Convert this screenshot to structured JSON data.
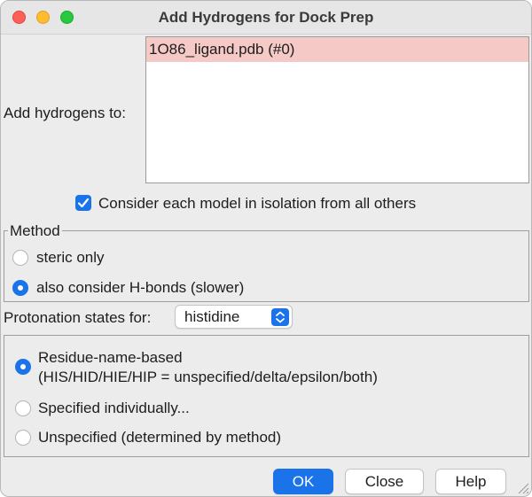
{
  "window": {
    "title": "Add Hydrogens for Dock Prep",
    "traffic_lights": [
      "close-icon",
      "minimize-icon",
      "zoom-icon"
    ]
  },
  "add_to": {
    "label": "Add hydrogens to:",
    "items": [
      "1O86_ligand.pdb (#0)"
    ],
    "selected_index": 0
  },
  "isolation": {
    "label": "Consider each model in isolation from all others",
    "checked": true
  },
  "method": {
    "legend": "Method",
    "options": [
      {
        "label": "steric only",
        "selected": false
      },
      {
        "label": "also consider H-bonds (slower)",
        "selected": true
      }
    ]
  },
  "protonation": {
    "label": "Protonation states for:",
    "selected": "histidine",
    "options": [
      {
        "label": "Residue-name-based",
        "detail": "(HIS/HID/HIE/HIP = unspecified/delta/epsilon/both)",
        "selected": true
      },
      {
        "label": "Specified individually...",
        "selected": false
      },
      {
        "label": "Unspecified (determined by method)",
        "selected": false
      }
    ]
  },
  "buttons": {
    "ok": "OK",
    "close": "Close",
    "help": "Help"
  },
  "colors": {
    "accent": "#1a73e8",
    "selection": "#f5c9c6",
    "window_bg": "#ececec"
  }
}
